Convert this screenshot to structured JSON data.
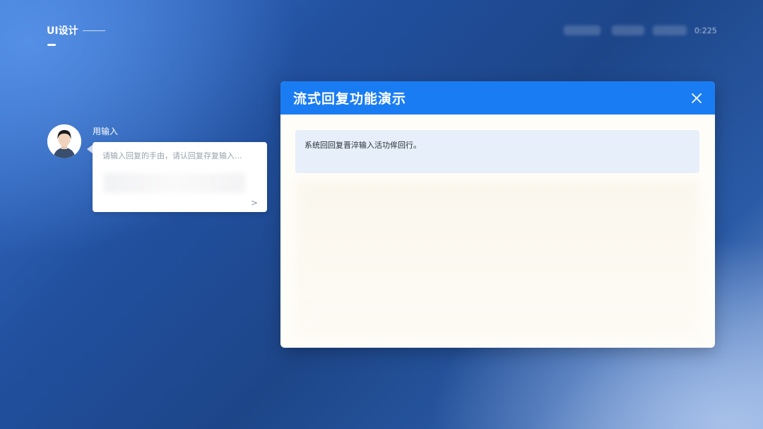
{
  "brand": {
    "title": "UI设计"
  },
  "top_bar": {
    "time": "0:225"
  },
  "user": {
    "label": "用输入"
  },
  "chat_input": {
    "placeholder": "请输入回复的手由，请认回复存复输入...",
    "send_symbol": ">"
  },
  "dialog": {
    "title": "流式回复功能演示",
    "close_symbol": "×",
    "response_text": "系统回回复晋淬输入活功侔回行。"
  },
  "colors": {
    "accent": "#1a7cf3",
    "response_bg": "#e6effa",
    "background_dark": "#1d4689"
  }
}
